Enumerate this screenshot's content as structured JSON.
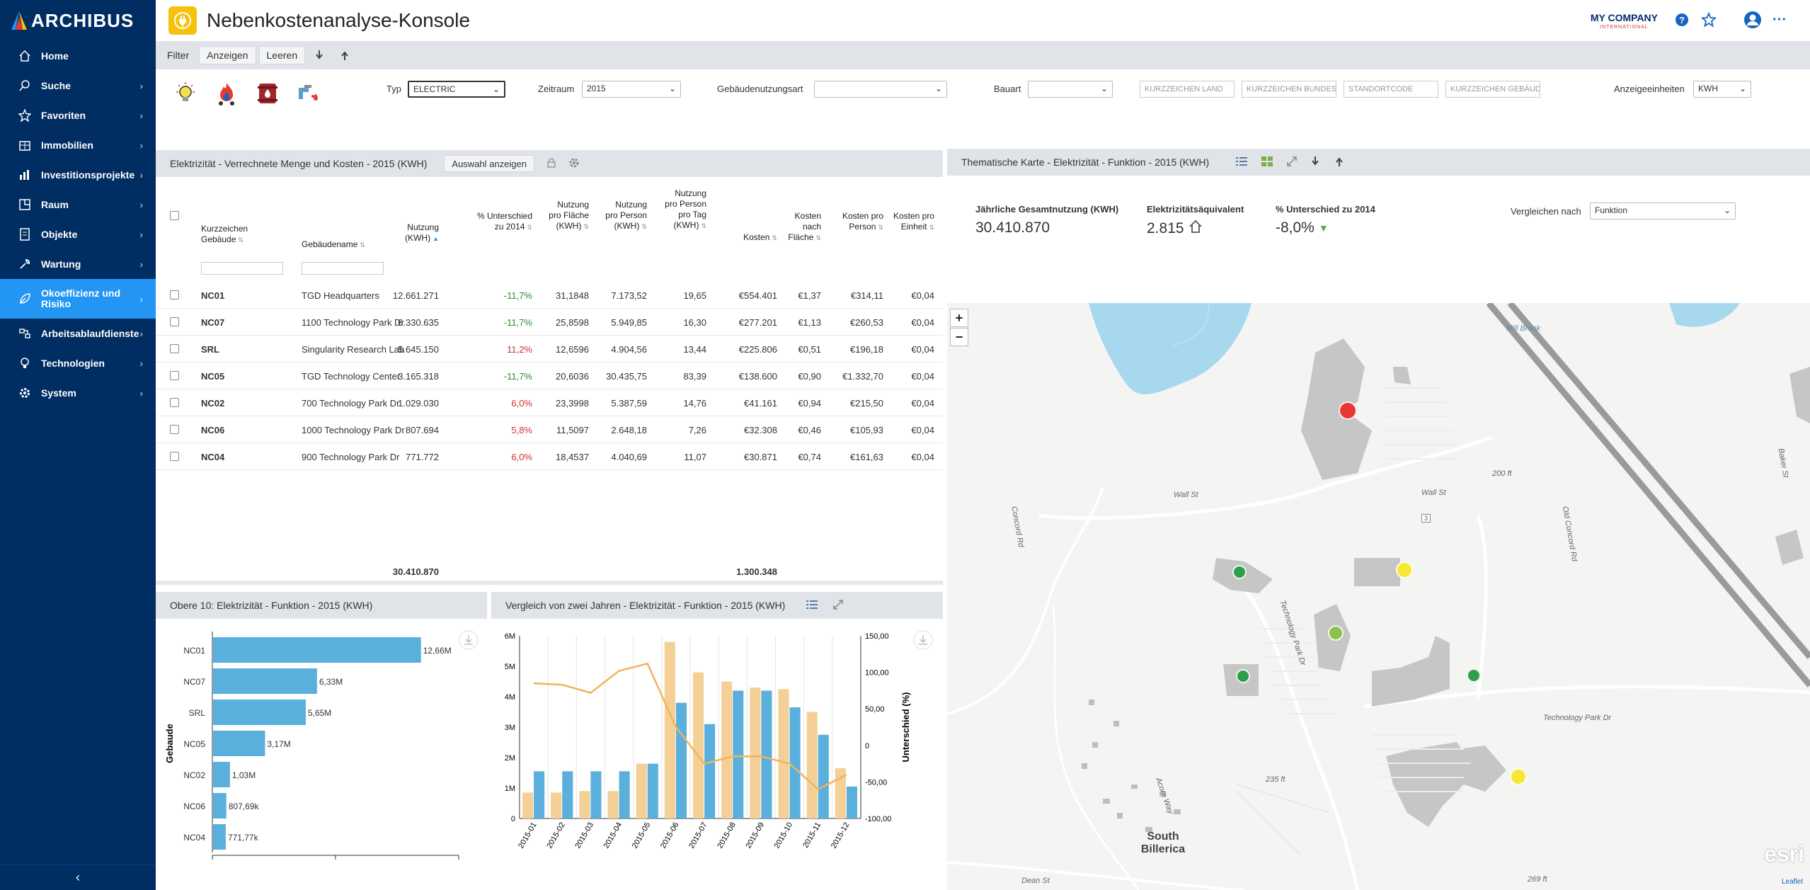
{
  "app": {
    "brand": "ARCHIBUS",
    "title": "Nebenkostenanalyse-Konsole",
    "company": "MY COMPANY",
    "company_sub": "INTERNATIONAL"
  },
  "sidebar": {
    "items": [
      {
        "label": "Home",
        "icon": "home-icon"
      },
      {
        "label": "Suche",
        "icon": "search-icon"
      },
      {
        "label": "Favoriten",
        "icon": "star-icon"
      },
      {
        "label": "Immobilien",
        "icon": "building-icon"
      },
      {
        "label": "Investitionsprojekte",
        "icon": "chart-icon"
      },
      {
        "label": "Raum",
        "icon": "floorplan-icon"
      },
      {
        "label": "Objekte",
        "icon": "document-icon"
      },
      {
        "label": "Wartung",
        "icon": "wrench-icon"
      },
      {
        "label": "Okoeffizienz und Risiko",
        "icon": "leaf-icon"
      },
      {
        "label": "Arbeitsablaufdienste",
        "icon": "workflow-icon"
      },
      {
        "label": "Technologien",
        "icon": "bulb-icon"
      },
      {
        "label": "System",
        "icon": "gear-icon"
      }
    ]
  },
  "toolbar": {
    "filter": "Filter",
    "show": "Anzeigen",
    "clear": "Leeren"
  },
  "filters": {
    "type_label": "Typ",
    "type_value": "ELECTRIC",
    "period_label": "Zeitraum",
    "period_value": "2015",
    "usage_label": "Gebäudenutzungsart",
    "usage_value": "",
    "construction_label": "Bauart",
    "construction_value": "",
    "ph_country": "KURZZEICHEN LAND",
    "ph_state": "KURZZEICHEN BUNDESLAND",
    "ph_site": "STANDORTCODE",
    "ph_building": "KURZZEICHEN GEBÄUDE",
    "units_label": "Anzeigeeinheiten",
    "units_value": "KWH"
  },
  "table": {
    "title": "Elektrizität - Verrechnete Menge und Kosten - 2015 (KWH)",
    "show_selection": "Auswahl anzeigen",
    "headers": [
      "Kurzzeichen Gebäude",
      "Gebäudename",
      "Nutzung (KWH)",
      "% Unterschied zu 2014",
      "Nutzung pro Fläche (KWH)",
      "Nutzung pro Person (KWH)",
      "Nutzung pro Person pro Tag (KWH)",
      "Kosten",
      "Kosten nach Fläche",
      "Kosten pro Person",
      "Kosten pro Einheit"
    ],
    "rows": [
      [
        "NC01",
        "TGD Headquarters",
        "12.661.271",
        "-11,7%",
        "31,1848",
        "7.173,52",
        "19,65",
        "€554.401",
        "€1,37",
        "€314,11",
        "€0,04"
      ],
      [
        "NC07",
        "1100 Technology Park Dr",
        "6.330.635",
        "-11,7%",
        "25,8598",
        "5.949,85",
        "16,30",
        "€277.201",
        "€1,13",
        "€260,53",
        "€0,04"
      ],
      [
        "SRL",
        "Singularity Research Lab",
        "5.645.150",
        "11,2%",
        "12,6596",
        "4.904,56",
        "13,44",
        "€225.806",
        "€0,51",
        "€196,18",
        "€0,04"
      ],
      [
        "NC05",
        "TGD Technology Center",
        "3.165.318",
        "-11,7%",
        "20,6036",
        "30.435,75",
        "83,39",
        "€138.600",
        "€0,90",
        "€1.332,70",
        "€0,04"
      ],
      [
        "NC02",
        "700 Technology Park Dr",
        "1.029.030",
        "6,0%",
        "23,3998",
        "5.387,59",
        "14,76",
        "€41.161",
        "€0,94",
        "€215,50",
        "€0,04"
      ],
      [
        "NC06",
        "1000 Technology Park Dr",
        "807.694",
        "5,8%",
        "11,5097",
        "2.648,18",
        "7,26",
        "€32.308",
        "€0,46",
        "€105,93",
        "€0,04"
      ],
      [
        "NC04",
        "900 Technology Park Dr",
        "771.772",
        "6,0%",
        "18,4537",
        "4.040,69",
        "11,07",
        "€30.871",
        "€0,74",
        "€161,63",
        "€0,04"
      ]
    ],
    "total_usage": "30.410.870",
    "total_cost": "1.300.348"
  },
  "map_panel": {
    "title": "Thematische Karte - Elektrizität - Funktion - 2015 (KWH)",
    "kpi1_label": "Jährliche Gesamtnutzung (KWH)",
    "kpi1_value": "30.410.870",
    "kpi2_label": "Elektrizitätsäquivalent",
    "kpi2_value": "2.815",
    "kpi3_label": "% Unterschied zu 2014",
    "kpi3_value": "-8,0%",
    "compare_label": "Vergleichen nach",
    "compare_value": "Funktion",
    "zoom_in": "+",
    "zoom_out": "−",
    "labels": {
      "wall1": "Wall St",
      "wall2": "Wall St",
      "concord": "Concord Rd",
      "oldconcord": "Old Concord Rd",
      "techpark1": "Technology Park Dr",
      "techpark2": "Technology Park Dr",
      "town": "South Billerica",
      "dean": "Dean St",
      "acorn": "Acorn Way",
      "brook": "Mill Brook",
      "elev1": "235 ft",
      "elev2": "269 ft",
      "elev3": "200 ft",
      "baker": "Baker St",
      "route": "3",
      "esri": "esri",
      "leaflet": "Leaflet"
    },
    "colors": {
      "red": "#e53935",
      "yellow": "#f7e733",
      "lightgreen": "#8bc34a",
      "green": "#2e9e4a"
    }
  },
  "chart_data": [
    {
      "type": "bar",
      "title": "Obere 10: Elektrizität - Funktion - 2015 (KWH)",
      "ylabel": "Gebaude",
      "orientation": "horizontal",
      "categories": [
        "NC01",
        "NC07",
        "SRL",
        "NC05",
        "NC02",
        "NC06",
        "NC04"
      ],
      "values": [
        12661271,
        6330635,
        5645150,
        3165318,
        1029030,
        807694,
        771772
      ],
      "data_labels": [
        "12,66M",
        "6,33M",
        "5,65M",
        "3,17M",
        "1,03M",
        "807,69k",
        "771,77k"
      ],
      "xlim": [
        0,
        15000000
      ],
      "color": "#5aafdc"
    },
    {
      "type": "bar",
      "title": "Vergleich von zwei Jahren - Elektrizität - Funktion - 2015 (KWH)",
      "y2label": "Unterschied (%)",
      "categories": [
        "2015-01",
        "2015-02",
        "2015-03",
        "2015-04",
        "2015-05",
        "2015-06",
        "2015-07",
        "2015-08",
        "2015-09",
        "2015-10",
        "2015-11",
        "2015-12"
      ],
      "ylim": [
        0,
        6000000
      ],
      "y_ticks": [
        "0",
        "1M",
        "2M",
        "3M",
        "4M",
        "5M",
        "6M"
      ],
      "y2lim": [
        -100,
        150
      ],
      "y2_ticks": [
        "-100,00",
        "-50,00",
        "0",
        "50,00",
        "100,00",
        "150,00"
      ],
      "series": [
        {
          "kind": "bar",
          "color": "#f4cf96",
          "values": [
            850000,
            850000,
            900000,
            900000,
            1800000,
            5800000,
            4800000,
            4500000,
            4300000,
            4250000,
            3500000,
            1650000
          ]
        },
        {
          "kind": "bar",
          "color": "#5aafdc",
          "values": [
            1550000,
            1550000,
            1550000,
            1550000,
            1800000,
            3800000,
            3100000,
            4200000,
            4200000,
            3650000,
            2750000,
            1050000
          ]
        },
        {
          "kind": "line",
          "color": "#f0b45a",
          "values": [
            85,
            83,
            72,
            102,
            112,
            25,
            -25,
            -15,
            -15,
            -25,
            -60,
            -40
          ]
        }
      ]
    }
  ]
}
